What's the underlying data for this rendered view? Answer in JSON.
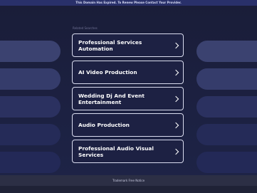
{
  "banner": {
    "text": "This Domain Has Expired. To Renew Please Contact Your Provider."
  },
  "related": {
    "heading": "Related Searches",
    "results": [
      {
        "label": "Professional Services Automation"
      },
      {
        "label": "AI Video Production"
      },
      {
        "label": "Wedding Dj And Event Entertainment"
      },
      {
        "label": "Audio Production"
      },
      {
        "label": "Professional Audio Visual Services"
      }
    ]
  },
  "footer": {
    "notice": "Trademark Free Notice"
  },
  "colors": {
    "background": "#1b1e3a",
    "banner": "#29306a",
    "button_border": "#d8dbee",
    "pill_light": "#3d4473",
    "pill_dark": "#262c55"
  },
  "icons": {
    "result_arrow": "chevron-right-icon"
  }
}
